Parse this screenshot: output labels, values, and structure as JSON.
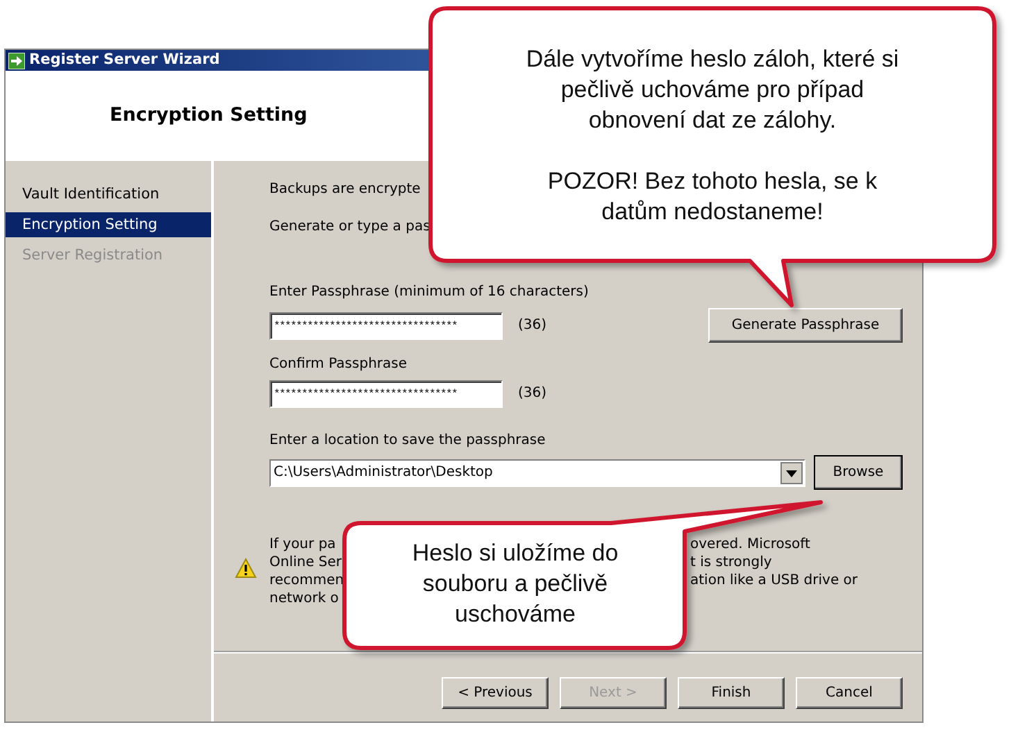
{
  "window": {
    "title": "Register Server Wizard"
  },
  "header": {
    "title": "Encryption Setting"
  },
  "sidebar": {
    "items": [
      {
        "label": "Vault Identification",
        "selected": false,
        "disabled": false
      },
      {
        "label": "Encryption Setting",
        "selected": true,
        "disabled": false
      },
      {
        "label": "Server Registration",
        "selected": false,
        "disabled": true
      }
    ]
  },
  "content": {
    "intro": [
      "Backups are encrypte",
      "Generate or type a pas"
    ],
    "passphrase": {
      "label": "Enter Passphrase (minimum of 16 characters)",
      "value": "*********************************",
      "count": "(36)"
    },
    "generate_button": "Generate Passphrase",
    "confirm": {
      "label": "Confirm Passphrase",
      "value": "*********************************",
      "count": "(36)"
    },
    "location": {
      "label": "Enter a location to save the passphrase",
      "value": "C:\\Users\\Administrator\\Desktop"
    },
    "browse_button": "Browse",
    "warning": {
      "left_lines": [
        "If your pa",
        "Online Ser",
        "recommen",
        "network o"
      ],
      "right_lines": [
        "overed. Microsoft",
        "t is strongly",
        "ation like a USB drive or"
      ]
    }
  },
  "buttons": [
    {
      "label": "< Previous",
      "disabled": false
    },
    {
      "label": "Next >",
      "disabled": true
    },
    {
      "label": "Finish",
      "disabled": false
    },
    {
      "label": "Cancel",
      "disabled": false
    }
  ],
  "callouts": [
    {
      "paragraphs": [
        "Dále vytvoříme heslo záloh, které si\npečlivě uchováme pro případ\nobnovení dat ze zálohy.",
        "POZOR! Bez tohoto hesla, se k\ndatům nedostaneme!"
      ]
    },
    {
      "paragraphs": [
        "Heslo si uložíme do\nsouboru a pečlivě\nuschováme"
      ]
    }
  ]
}
